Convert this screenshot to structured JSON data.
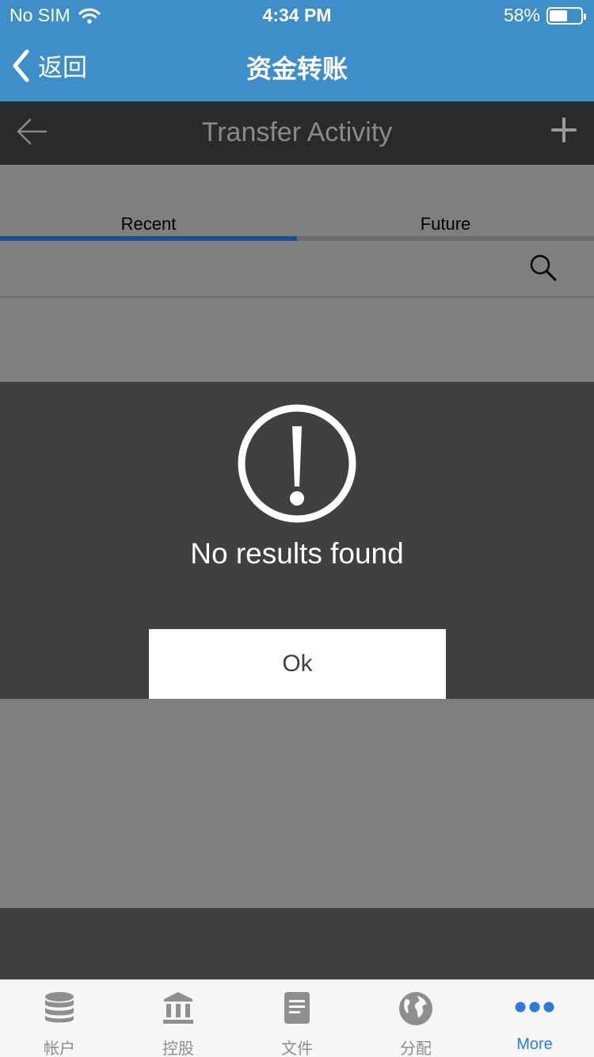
{
  "status_bar": {
    "carrier": "No SIM",
    "time": "4:34 PM",
    "battery_percent": "58%",
    "battery_level": 0.58,
    "icons": [
      "wifi-icon",
      "battery-icon"
    ]
  },
  "ios_nav": {
    "back_label": "返回",
    "title": "资金转账"
  },
  "app_header": {
    "title": "Transfer Activity",
    "back_icon": "arrow-left-icon",
    "add_icon": "plus-icon"
  },
  "tabs": [
    {
      "label": "Recent",
      "active": true
    },
    {
      "label": "Future",
      "active": false
    }
  ],
  "search": {
    "icon": "search-icon"
  },
  "dialog": {
    "icon": "exclamation-circle-icon",
    "message": "No results found",
    "ok_label": "Ok"
  },
  "tabbar": {
    "items": [
      {
        "label": "帐户",
        "icon": "database-icon",
        "active": false
      },
      {
        "label": "控股",
        "icon": "bank-icon",
        "active": false
      },
      {
        "label": "文件",
        "icon": "document-icon",
        "active": false
      },
      {
        "label": "分配",
        "icon": "globe-icon",
        "active": false
      },
      {
        "label": "More",
        "icon": "more-dots-icon",
        "active": true
      }
    ]
  },
  "colors": {
    "ios_blue": "#3d8ec9",
    "header_dark": "#2a2a2a",
    "overlay_gray": "#7f7f7f",
    "dialog_bg": "#404040",
    "tab_active_underline": "#1f4f8e",
    "tabbar_active": "#2f7bd9"
  }
}
